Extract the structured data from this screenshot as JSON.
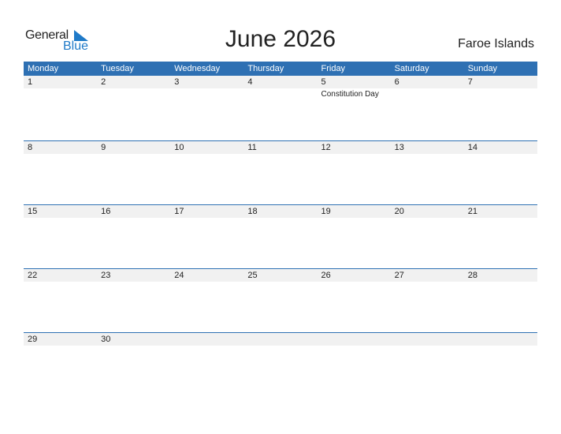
{
  "logo": {
    "line1": "General",
    "line2": "Blue"
  },
  "title": "June 2026",
  "country": "Faroe Islands",
  "colors": {
    "header": "#2e70b3",
    "strip": "#f1f1f1",
    "brand": "#1f7ac8"
  },
  "weekdays": [
    "Monday",
    "Tuesday",
    "Wednesday",
    "Thursday",
    "Friday",
    "Saturday",
    "Sunday"
  ],
  "weeks": [
    [
      {
        "d": "1"
      },
      {
        "d": "2"
      },
      {
        "d": "3"
      },
      {
        "d": "4"
      },
      {
        "d": "5",
        "event": "Constitution Day"
      },
      {
        "d": "6"
      },
      {
        "d": "7"
      }
    ],
    [
      {
        "d": "8"
      },
      {
        "d": "9"
      },
      {
        "d": "10"
      },
      {
        "d": "11"
      },
      {
        "d": "12"
      },
      {
        "d": "13"
      },
      {
        "d": "14"
      }
    ],
    [
      {
        "d": "15"
      },
      {
        "d": "16"
      },
      {
        "d": "17"
      },
      {
        "d": "18"
      },
      {
        "d": "19"
      },
      {
        "d": "20"
      },
      {
        "d": "21"
      }
    ],
    [
      {
        "d": "22"
      },
      {
        "d": "23"
      },
      {
        "d": "24"
      },
      {
        "d": "25"
      },
      {
        "d": "26"
      },
      {
        "d": "27"
      },
      {
        "d": "28"
      }
    ],
    [
      {
        "d": "29"
      },
      {
        "d": "30"
      },
      {
        "d": ""
      },
      {
        "d": ""
      },
      {
        "d": ""
      },
      {
        "d": ""
      },
      {
        "d": ""
      }
    ]
  ]
}
